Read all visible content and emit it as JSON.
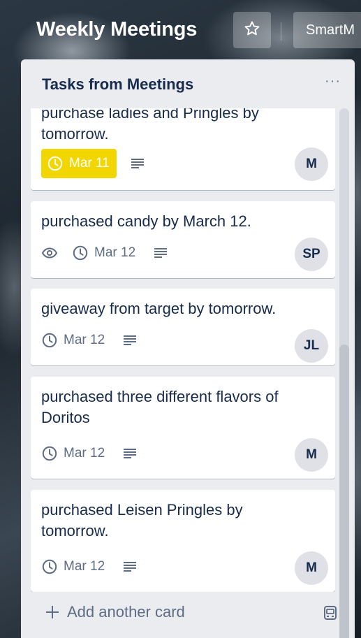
{
  "board": {
    "title": "Weekly Meetings",
    "team_label": "SmartM"
  },
  "list": {
    "title": "Tasks from Meetings",
    "menu_glyph": "···",
    "add_card_label": "Add another card",
    "cards": [
      {
        "title": "purchase ladies and Pringles by tomorrow.",
        "due": "Mar 11",
        "due_state": "due-soon",
        "has_watch": false,
        "has_description": true,
        "member": "M"
      },
      {
        "title": "purchased candy by March 12.",
        "due": "Mar 12",
        "due_state": "normal",
        "has_watch": true,
        "has_description": true,
        "member": "SP"
      },
      {
        "title": "giveaway from target by tomorrow.",
        "due": "Mar 12",
        "due_state": "normal",
        "has_watch": false,
        "has_description": true,
        "member": "JL"
      },
      {
        "title": "purchased three different flavors of Doritos",
        "due": "Mar 12",
        "due_state": "normal",
        "has_watch": false,
        "has_description": true,
        "member": "M"
      },
      {
        "title": "purchased Leisen Pringles by tomorrow.",
        "due": "Mar 12",
        "due_state": "normal",
        "has_watch": false,
        "has_description": true,
        "member": "M"
      }
    ]
  },
  "colors": {
    "due_soon": "#f2d600",
    "list_bg": "#ebecf0",
    "text": "#172b4d",
    "muted": "#5e6c84"
  },
  "icons": {
    "star": "star-icon",
    "clock": "clock-icon",
    "watch": "eye-icon",
    "description": "description-icon",
    "add": "plus-icon",
    "template": "card-template-icon"
  }
}
